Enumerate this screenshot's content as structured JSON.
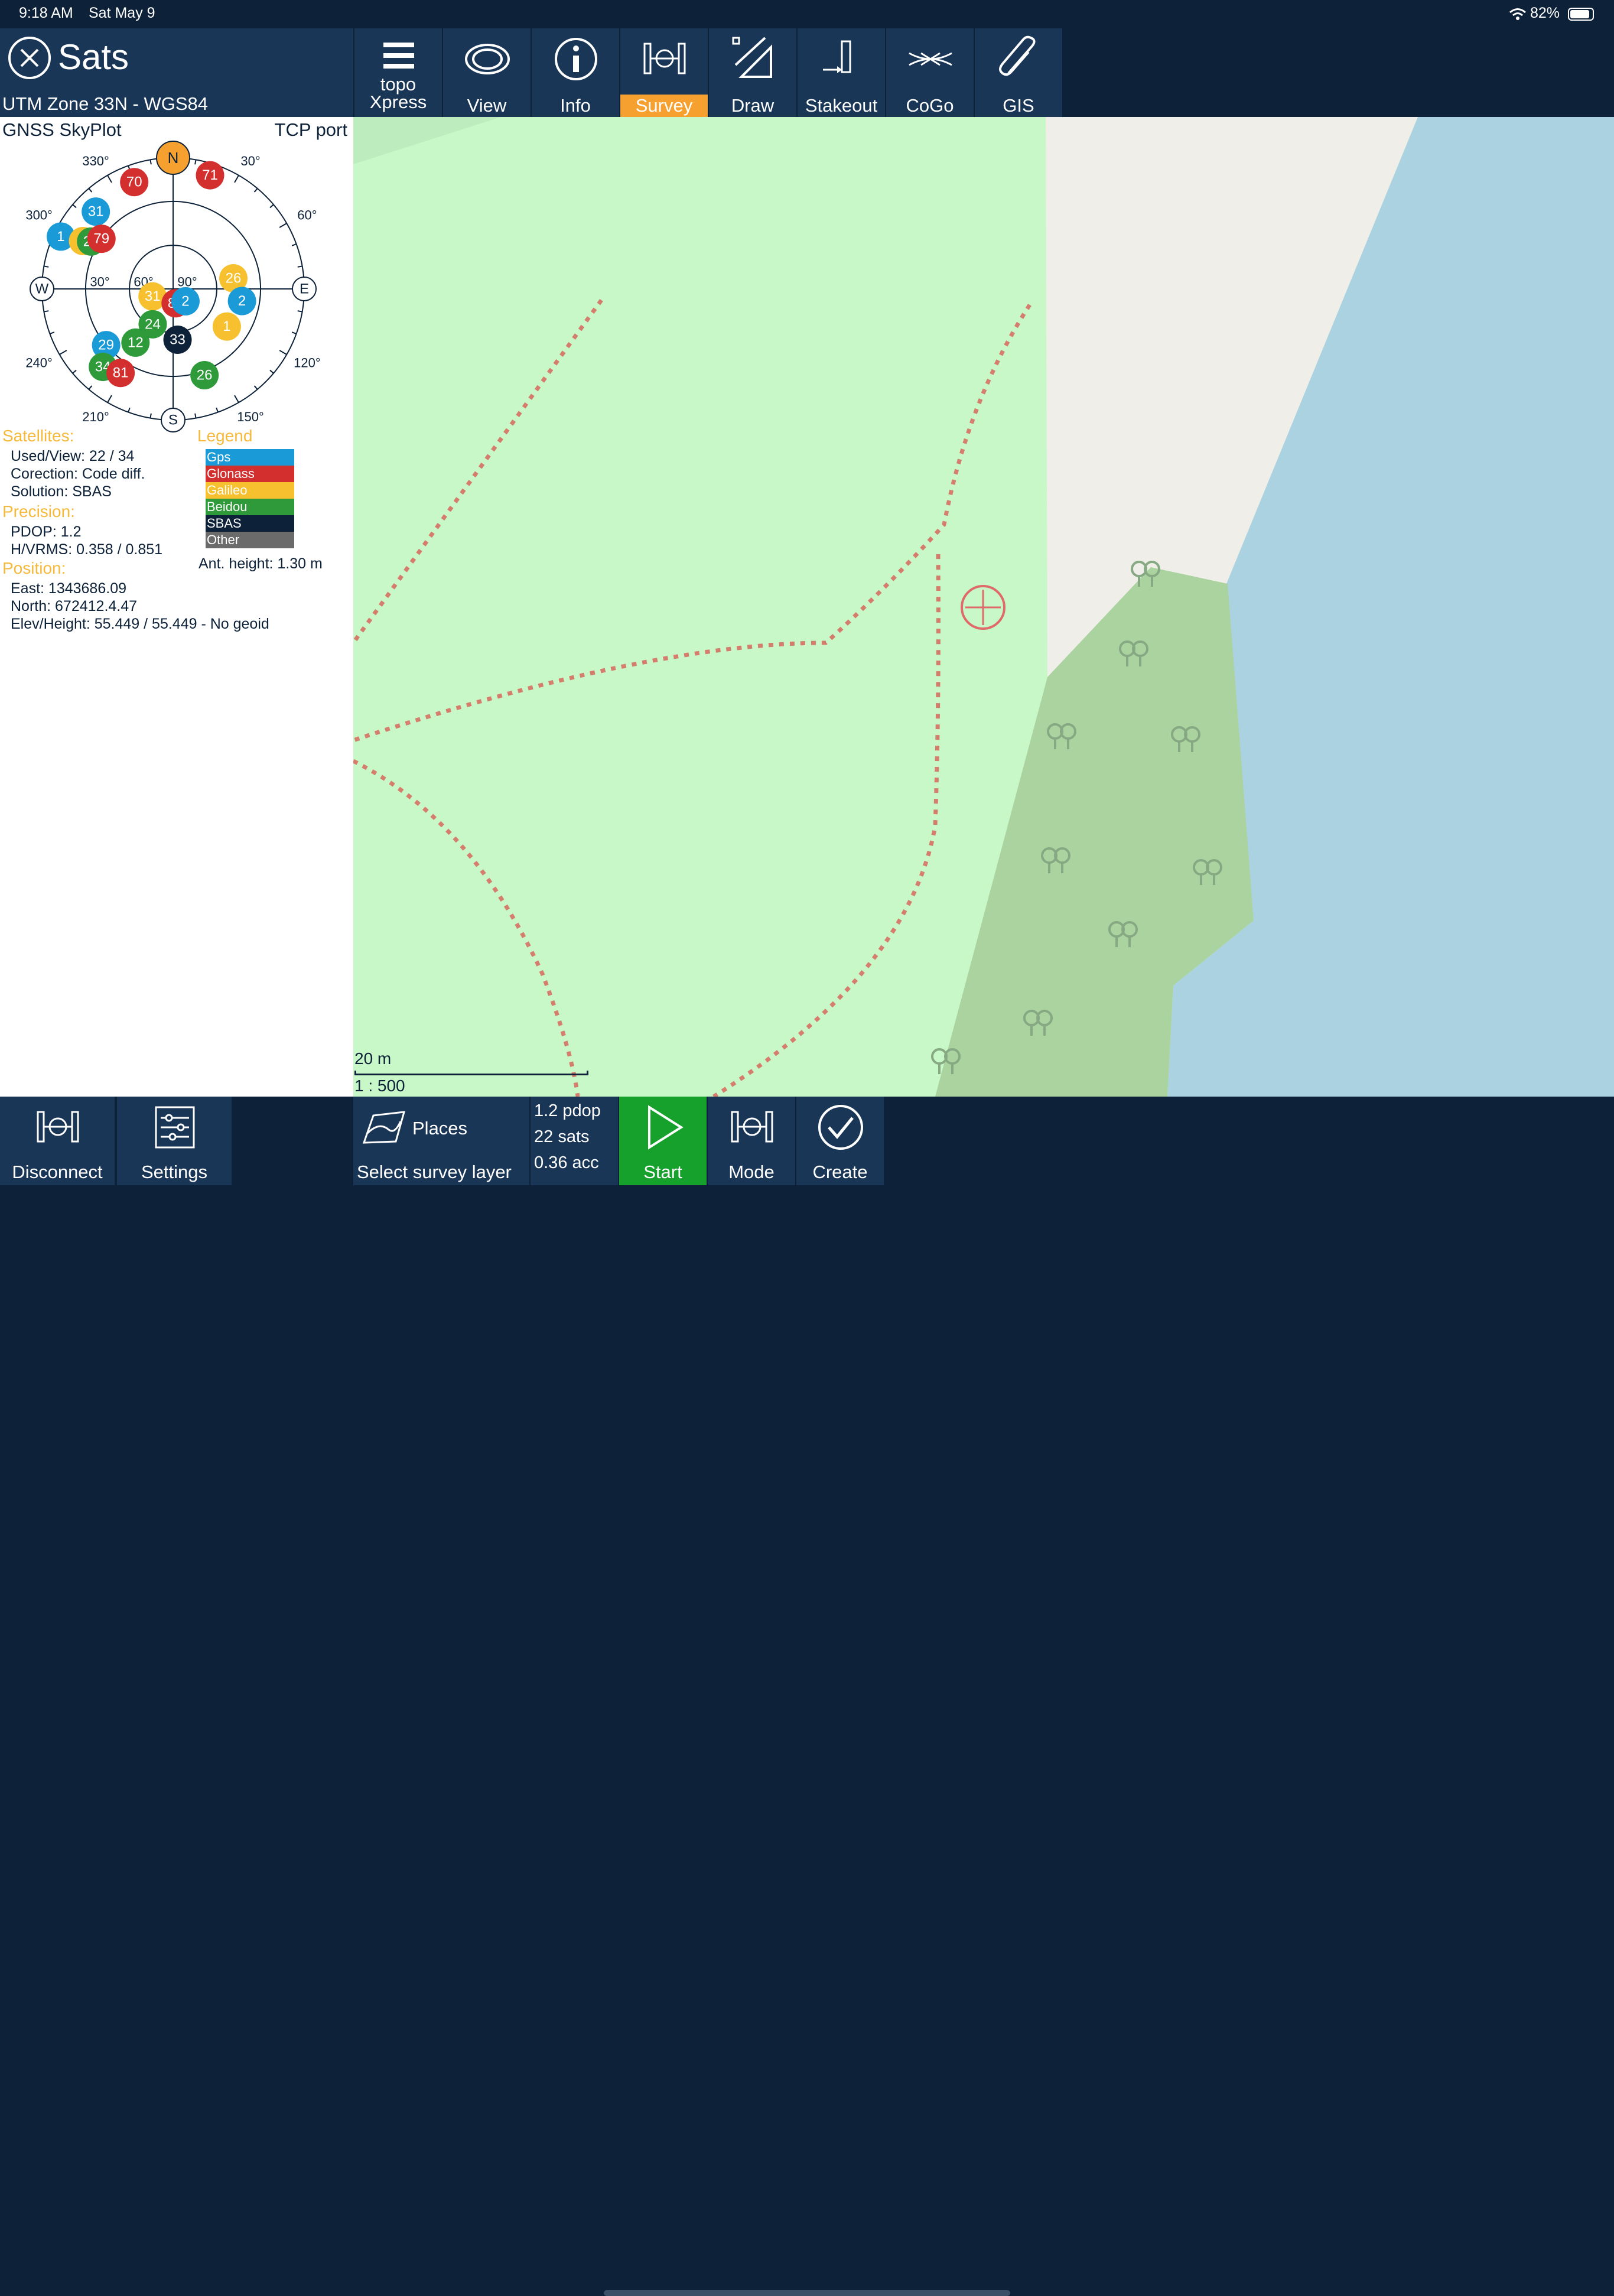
{
  "status": {
    "time": "9:18 AM",
    "date": "Sat May 9",
    "battery": "82%"
  },
  "header": {
    "title": "Sats",
    "projection": "UTM Zone 33N - WGS84"
  },
  "toolbar": [
    {
      "label": "topo\nXpress",
      "line1": "topo",
      "line2": "Xpress",
      "icon": "menu-icon"
    },
    {
      "label": "View",
      "icon": "eye-icon"
    },
    {
      "label": "Info",
      "icon": "info-icon"
    },
    {
      "label": "Survey",
      "icon": "survey-pole-icon",
      "active": true
    },
    {
      "label": "Draw",
      "icon": "draw-icon"
    },
    {
      "label": "Stakeout",
      "icon": "stakeout-icon"
    },
    {
      "label": "CoGo",
      "icon": "cogo-icon"
    },
    {
      "label": "GIS",
      "icon": "paperclip-icon"
    }
  ],
  "skyplot": {
    "title": "GNSS SkyPlot",
    "source": "TCP port",
    "compass": {
      "n": "N",
      "e": "E",
      "s": "S",
      "w": "W"
    },
    "bearings": [
      "30°",
      "60°",
      "120°",
      "150°",
      "210°",
      "240°",
      "300°",
      "330°"
    ],
    "rings": [
      "30°",
      "60°",
      "90°"
    ],
    "satellites": [
      {
        "id": "70",
        "system": "Glonass",
        "az": 340,
        "el": 12
      },
      {
        "id": "71",
        "system": "Glonass",
        "az": 18,
        "el": 8
      },
      {
        "id": "31",
        "system": "Gps",
        "az": 315,
        "el": 15
      },
      {
        "id": "1",
        "system": "Gps",
        "az": 295,
        "el": 5
      },
      {
        "id": "2",
        "system": "Galileo",
        "az": 298,
        "el": 20
      },
      {
        "id": "25",
        "system": "Beidou",
        "az": 300,
        "el": 25
      },
      {
        "id": "79",
        "system": "Glonass",
        "az": 305,
        "el": 30
      },
      {
        "id": "26",
        "system": "Galileo",
        "az": 80,
        "el": 48
      },
      {
        "id": "2",
        "system": "Gps",
        "az": 100,
        "el": 42
      },
      {
        "id": "31",
        "system": "Galileo",
        "az": 250,
        "el": 75
      },
      {
        "id": "88",
        "system": "Glonass",
        "az": 170,
        "el": 80
      },
      {
        "id": "2",
        "system": "Gps",
        "az": 135,
        "el": 78
      },
      {
        "id": "24",
        "system": "Beidou",
        "az": 210,
        "el": 62
      },
      {
        "id": "1",
        "system": "Galileo",
        "az": 125,
        "el": 45
      },
      {
        "id": "29",
        "system": "Gps",
        "az": 230,
        "el": 30
      },
      {
        "id": "12",
        "system": "Beidou",
        "az": 215,
        "el": 45
      },
      {
        "id": "33",
        "system": "SBAS",
        "az": 175,
        "el": 55
      },
      {
        "id": "34",
        "system": "Beidou",
        "az": 222,
        "el": 18
      },
      {
        "id": "81",
        "system": "Glonass",
        "az": 212,
        "el": 22
      },
      {
        "id": "26",
        "system": "Beidou",
        "az": 160,
        "el": 27
      }
    ]
  },
  "info": {
    "satellites_head": "Satellites:",
    "used_view": "Used/View: 22 / 34",
    "correction": "Corection: Code diff.",
    "solution": "Solution: SBAS",
    "precision_head": "Precision:",
    "pdop": "PDOP: 1.2",
    "rms": "H/VRMS: 0.358 / 0.851",
    "position_head": "Position:",
    "east": "East: 1343686.09",
    "north": "North: 672412.4.47",
    "elev": "Elev/Height: 55.449 / 55.449 - No geoid",
    "ant_height": "Ant. height: 1.30 m"
  },
  "legend": {
    "head": "Legend",
    "items": [
      {
        "label": "Gps",
        "color": "#1a9bd7"
      },
      {
        "label": "Glonass",
        "color": "#d32f2f"
      },
      {
        "label": "Galileo",
        "color": "#f6c02e"
      },
      {
        "label": "Beidou",
        "color": "#2e9a3a"
      },
      {
        "label": "SBAS",
        "color": "#0d2138"
      },
      {
        "label": "Other",
        "color": "#6b6b6b"
      }
    ]
  },
  "map": {
    "scale": "20 m",
    "ratio": "1 : 500"
  },
  "bottom": {
    "disconnect": "Disconnect",
    "settings": "Settings",
    "places": "Places",
    "select_layer": "Select survey layer",
    "pdop": "1.2 pdop",
    "sats": "22 sats",
    "acc": "0.36 acc",
    "start": "Start",
    "mode": "Mode",
    "create": "Create"
  },
  "colors": {
    "accent": "#f6a030",
    "panel": "#1a3656",
    "start": "#16a02c"
  }
}
